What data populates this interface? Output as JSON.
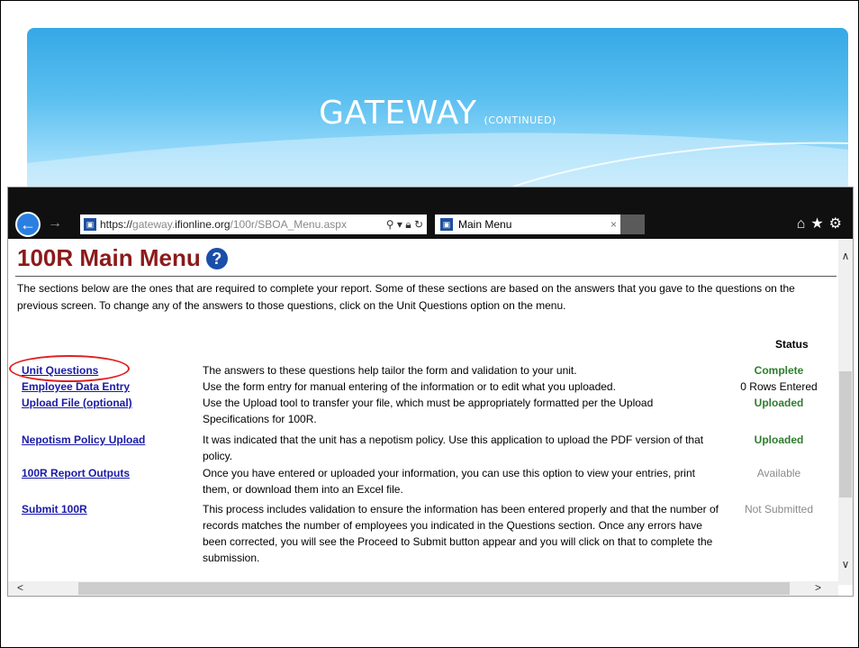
{
  "slide": {
    "title": "GATEWAY",
    "subtitle": "(CONTINUED)"
  },
  "browser": {
    "back_icon": "back-arrow-icon",
    "url_scheme": "https://",
    "url_pre": "gateway.",
    "url_host": "ifionline.org",
    "url_path": "/100r/SBOA_Menu.aspx",
    "tab_title": "Main Menu",
    "tab_close": "×",
    "toolbar": [
      "home-icon",
      "favorites-icon",
      "settings-icon"
    ]
  },
  "page": {
    "title": "100R Main Menu",
    "help": "?",
    "intro": "The sections below are the ones that are required to complete your report. Some of these sections are based on the answers that you gave to the questions on the previous screen. To change any of the answers to those questions, click on the Unit Questions option on the menu.",
    "status_header": "Status",
    "rows": [
      {
        "name": "Unit Questions",
        "desc": "The answers to these questions help tailor the form and validation to your unit.",
        "status": "Complete"
      },
      {
        "name": "Employee Data Entry",
        "desc": "Use the form entry for manual entering of the information or to edit what you uploaded.",
        "status": "0 Rows Entered"
      },
      {
        "name": "Upload File (optional)",
        "desc": "Use the Upload tool to transfer your file, which must be appropriately formatted per the Upload Specifications for 100R.",
        "status": "Uploaded"
      },
      {
        "name": "Nepotism Policy Upload",
        "desc": "It was indicated that the unit has a nepotism policy. Use this application to upload the PDF version of that policy.",
        "status": "Uploaded"
      },
      {
        "name": "100R Report Outputs",
        "desc": "Once you have entered or uploaded your information, you can use this option to view your entries, print them, or download them into an Excel file.",
        "status": "Available"
      },
      {
        "name": "Submit 100R",
        "desc": "This process includes validation to ensure the information has been entered properly and that the number of records matches the number of employees you indicated in the Questions section. Once any errors have been corrected, you will see the Proceed to Submit button appear and you will click on that to complete the submission.",
        "status": "Not Submitted"
      }
    ]
  },
  "colors": {
    "title": "#8b1a1a",
    "link": "#1a1aa6",
    "status_green": "#2e7d2e",
    "status_grey": "#8a8a8a",
    "highlight": "#e02020"
  }
}
